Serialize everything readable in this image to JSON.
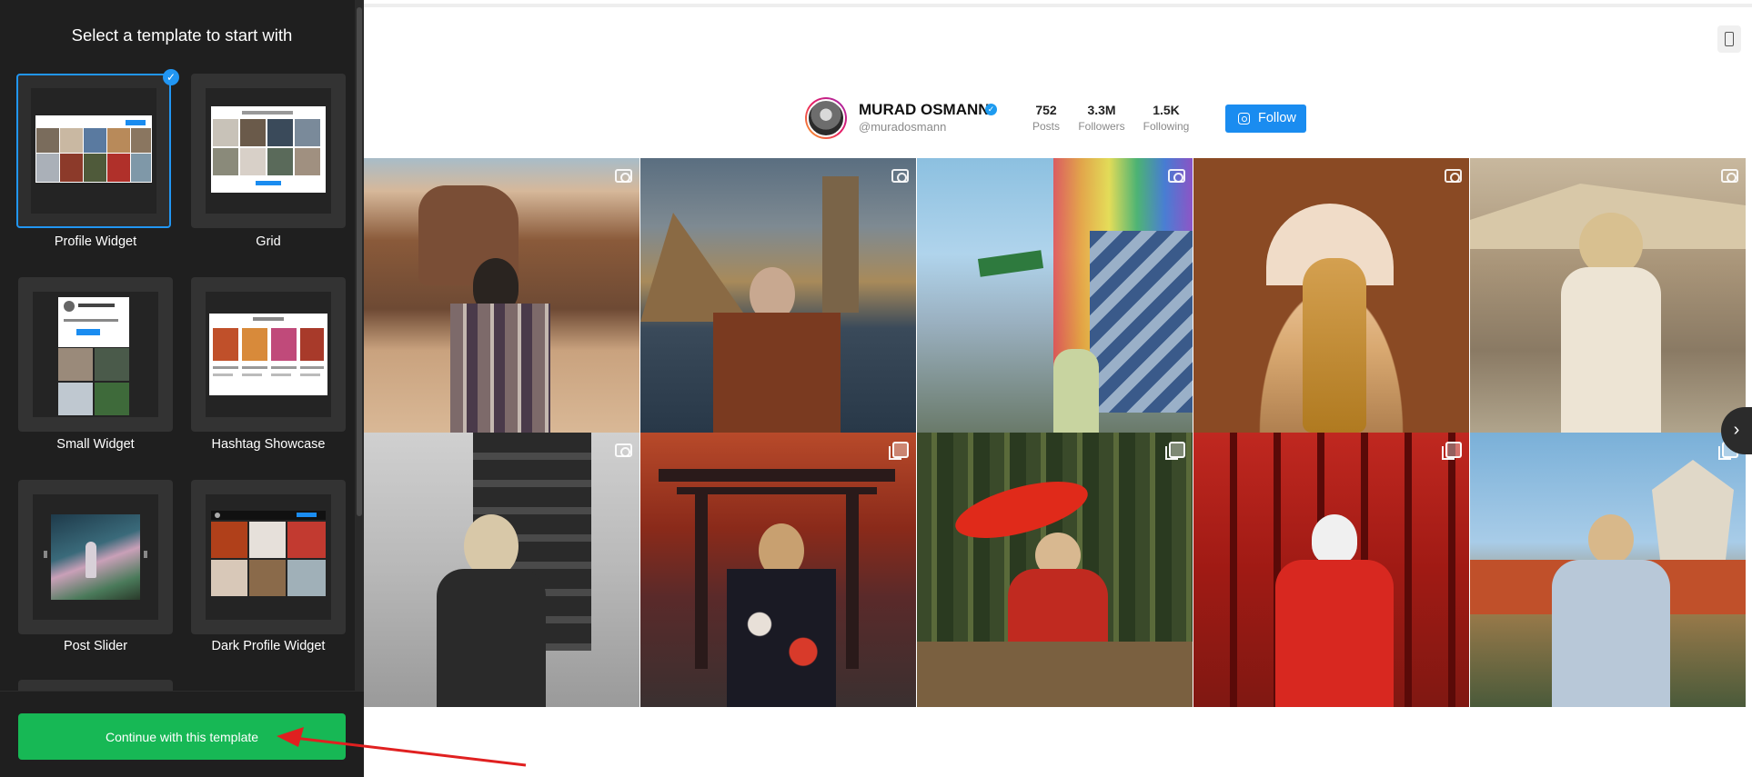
{
  "sidebar": {
    "title": "Select a template to start with",
    "templates": [
      {
        "label": "Profile Widget",
        "selected": true
      },
      {
        "label": "Grid",
        "selected": false
      },
      {
        "label": "Small Widget",
        "selected": false
      },
      {
        "label": "Hashtag Showcase",
        "selected": false
      },
      {
        "label": "Post Slider",
        "selected": false
      },
      {
        "label": "Dark Profile Widget",
        "selected": false
      }
    ],
    "continue_label": "Continue with this template",
    "selected_icon": "check-icon"
  },
  "preview": {
    "profile": {
      "name": "MURAD OSMANN",
      "handle": "@muradosmann",
      "verified_icon": "verified-icon",
      "stats": [
        {
          "value": "752",
          "label": "Posts"
        },
        {
          "value": "3.3M",
          "label": "Followers"
        },
        {
          "value": "1.5K",
          "label": "Following"
        }
      ],
      "follow_label": "Follow",
      "follow_icon": "instagram-icon"
    },
    "photos": [
      {
        "desc_icon": "camera-icon",
        "scene": "desert-rock"
      },
      {
        "desc_icon": "camera-icon",
        "scene": "lighthouse-sea"
      },
      {
        "desc_icon": "camera-icon",
        "scene": "rainbow-building"
      },
      {
        "desc_icon": "camera-icon",
        "scene": "taj-mahal"
      },
      {
        "desc_icon": "camera-icon",
        "scene": "modern-architecture"
      },
      {
        "desc_icon": "camera-icon",
        "scene": "airport"
      },
      {
        "desc_icon": "multi-icon",
        "scene": "torii-gate"
      },
      {
        "desc_icon": "multi-icon",
        "scene": "bamboo-forest"
      },
      {
        "desc_icon": "multi-icon",
        "scene": "red-torii"
      },
      {
        "desc_icon": "multi-icon",
        "scene": "castle-garden"
      }
    ],
    "next_icon": "chevron-right-icon",
    "device_icon": "mobile-device-icon"
  },
  "colors": {
    "sidebar_bg": "#1f1f1f",
    "selected_border": "#2196f3",
    "continue_btn": "#17b855",
    "follow_btn": "#1a8cf0",
    "annotation": "#e02020"
  }
}
